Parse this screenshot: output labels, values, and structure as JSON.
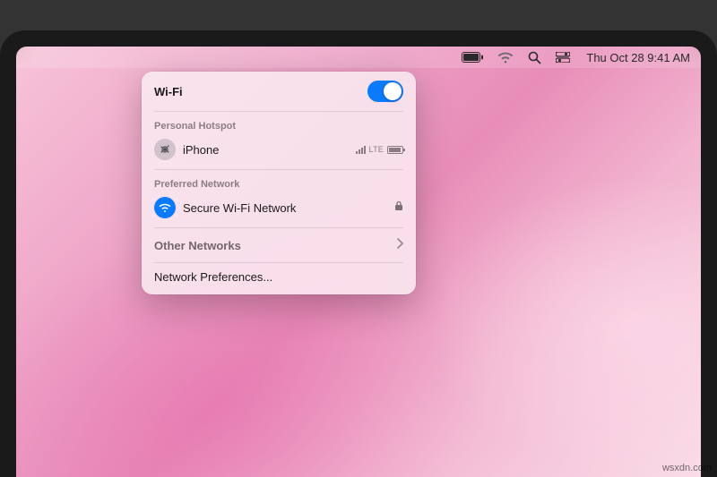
{
  "menubar": {
    "clock_text": "Thu Oct 28  9:41 AM"
  },
  "wifi_panel": {
    "title": "Wi-Fi",
    "toggle_on": true,
    "personal_hotspot": {
      "label": "Personal Hotspot",
      "device": "iPhone",
      "signal_type": "LTE"
    },
    "preferred_network": {
      "label": "Preferred Network",
      "name": "Secure Wi-Fi Network",
      "locked": true
    },
    "other_networks_label": "Other Networks",
    "prefs_label": "Network Preferences..."
  },
  "watermark": "wsxdn.com"
}
